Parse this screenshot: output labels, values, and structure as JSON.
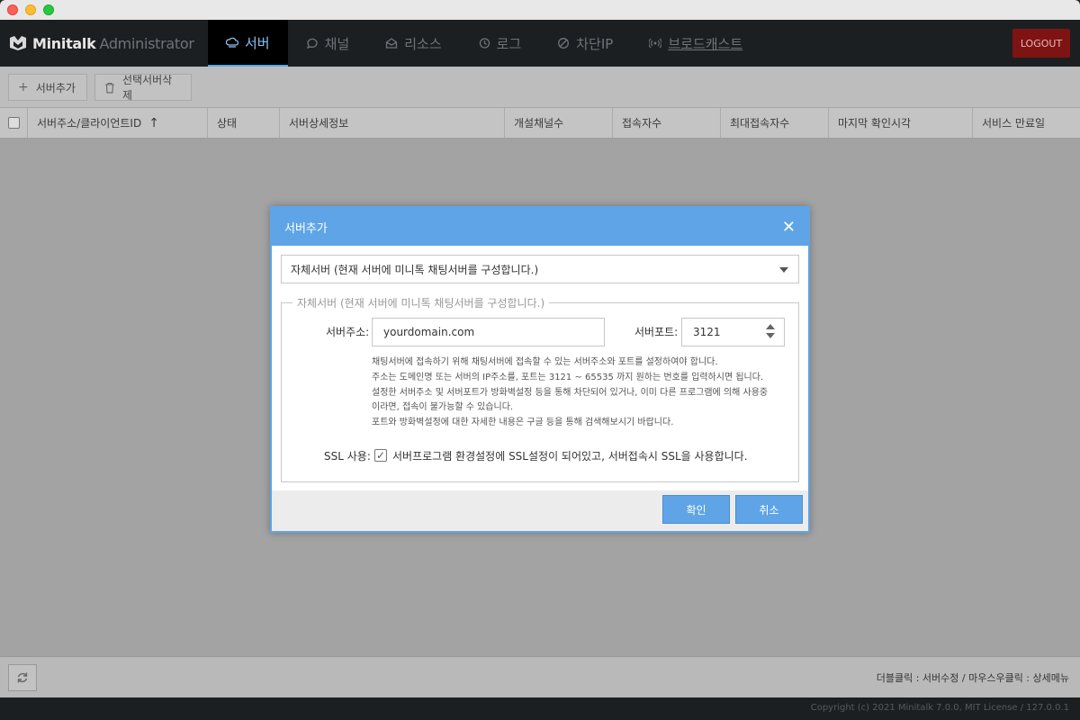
{
  "app": {
    "brand_name": "Minitalk",
    "brand_suffix": "Administrator",
    "logout_label": "LOGOUT"
  },
  "nav": {
    "items": [
      {
        "label": "서버",
        "icon": "cloud-icon"
      },
      {
        "label": "채널",
        "icon": "chat-icon"
      },
      {
        "label": "리소스",
        "icon": "box-icon"
      },
      {
        "label": "로그",
        "icon": "history-icon"
      },
      {
        "label": "차단IP",
        "icon": "ban-icon"
      },
      {
        "label": "브로드캐스트",
        "icon": "broadcast-icon"
      }
    ]
  },
  "toolbar": {
    "add_server": "서버추가",
    "delete_selected": "선택서버삭제"
  },
  "grid": {
    "columns": [
      "서버주소/클라이언트ID",
      "상태",
      "서버상세정보",
      "개설채널수",
      "접속자수",
      "최대접속자수",
      "마지막 확인시각",
      "서비스 만료일"
    ],
    "sort_indicator": "↑"
  },
  "footer": {
    "hint": "더블클릭 : 서버수정 / 마우스우클릭 : 상세메뉴",
    "copyright": "Copyright (c) 2021 Minitalk 7.0.0, MIT License / 127.0.0.1"
  },
  "modal": {
    "title": "서버추가",
    "server_type": "자체서버 (현재 서버에 미니톡 채팅서버를 구성합니다.)",
    "fieldset_legend": "자체서버 (현재 서버에 미니톡 채팅서버를 구성합니다.)",
    "address_label": "서버주소:",
    "address_value": "yourdomain.com",
    "port_label": "서버포트:",
    "port_value": "3121",
    "help_lines": [
      "채팅서버에 접속하기 위해 채팅서버에 접속할 수 있는 서버주소와 포트를 설정하여야 합니다.",
      "주소는 도메인명 또는 서버의 IP주소를, 포트는 3121 ~ 65535 까지 원하는 번호를 입력하시면 됩니다.",
      "설정한 서버주소 및 서버포트가 방화벽설정 등을 통해 차단되어 있거나, 이미 다른 프로그램에 의해 사용중",
      "이라면, 접속이 불가능할 수 있습니다.",
      "포트와 방화벽설정에 대한 자세한 내용은 구글 등을 통해 검색해보시기 바랍니다."
    ],
    "ssl_label": "SSL 사용:",
    "ssl_checked": true,
    "ssl_text": "서버프로그램 환경설정에 SSL설정이 되어있고, 서버접속시 SSL을 사용합니다.",
    "confirm": "확인",
    "cancel": "취소"
  },
  "colors": {
    "accent": "#5ea4e6",
    "logout_bg": "#7e1314",
    "header_bg": "#1c1f22"
  }
}
